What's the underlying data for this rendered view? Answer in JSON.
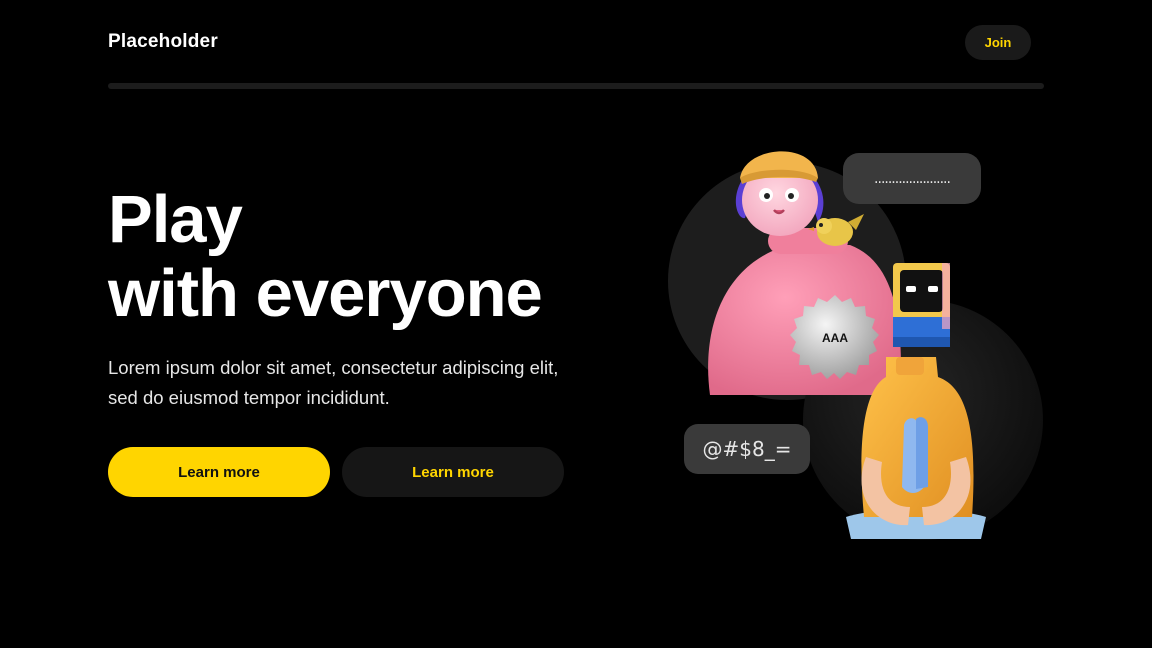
{
  "nav": {
    "brand": "Placeholder",
    "join_label": "Join"
  },
  "hero": {
    "title_line1": "Play",
    "title_line2": "with everyone",
    "description": "Lorem ipsum dolor sit amet, consectetur adipiscing elit, sed do eiusmod tempor incididunt.",
    "primary_button": "Learn more",
    "secondary_button": "Learn more"
  },
  "illustration": {
    "speech_bubble_top": "......................",
    "speech_bubble_bottom": "@#$8_=",
    "badge_text": "AAA"
  },
  "colors": {
    "background": "#000000",
    "accent": "#ffd500",
    "surface": "#161616"
  }
}
